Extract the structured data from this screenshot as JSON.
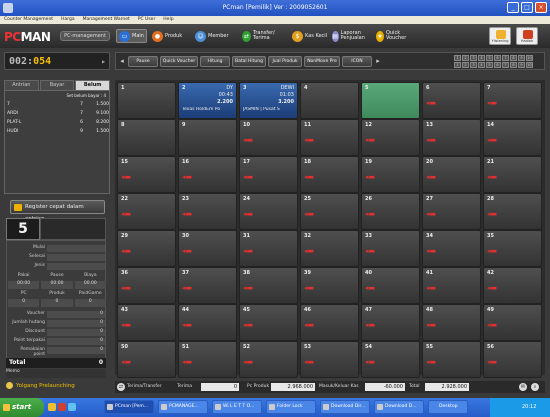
{
  "window": {
    "title": "PCman [Pemilik]  Ver : 2009052601",
    "minimize": "_",
    "maximize": "□",
    "close": "×"
  },
  "menu": [
    "Counter Management",
    "Harga",
    "Management Warnet",
    "PC User",
    "Help"
  ],
  "logo": {
    "pc": "PC",
    "man": "MAN",
    "mode": "PC-management"
  },
  "nav": [
    {
      "label": "Main",
      "icon": "monitor-icon",
      "color": "#2a6fd6"
    },
    {
      "label": "Produk",
      "icon": "cup-icon",
      "color": "#e07020"
    },
    {
      "label": "Member",
      "icon": "members-icon",
      "color": "#4b8fd6"
    },
    {
      "label": "Transfer/ Terima",
      "icon": "transfer-icon",
      "color": "#30a030"
    },
    {
      "label": "Kas Kecil",
      "icon": "cash-icon",
      "color": "#e0a020"
    },
    {
      "label": "Laporan Penjualan",
      "icon": "report-icon",
      "color": "#8a8ad0"
    },
    {
      "label": "Quick Voucher",
      "icon": "voucher-icon",
      "color": "#e8b000"
    }
  ],
  "rightButtons": [
    {
      "label": "Ylistening",
      "icon": "person-icon"
    },
    {
      "label": "Hadiah",
      "icon": "gift-icon"
    }
  ],
  "counter": {
    "prefix": "002:",
    "value": "054"
  },
  "toolbar": [
    "Pause",
    "Quick Voucher",
    "Hitung",
    "Batal Hitung",
    "Jual Produk",
    "NonMove Pre",
    "ICON"
  ],
  "keys": [
    "1",
    "2",
    "3",
    "4",
    "5",
    "6",
    "7",
    "8",
    "9",
    "10",
    "1",
    "2",
    "3",
    "4",
    "5",
    "6",
    "7",
    "8",
    "9",
    "10"
  ],
  "tabs": [
    "Antrian",
    "Bayar",
    "Belum Bayar"
  ],
  "waiting": {
    "subtitle": "Set belum bayar : 4",
    "rows": [
      {
        "name": "7",
        "qty": "7",
        "amount": "1.500"
      },
      {
        "name": "ARDI",
        "qty": "7",
        "amount": "9.100"
      },
      {
        "name": "PLAT-L",
        "qty": "6",
        "amount": "8.200"
      },
      {
        "name": "HUDI",
        "qty": "9",
        "amount": "1.500"
      }
    ]
  },
  "register": "Register cepat dalam antrian",
  "big": "5",
  "info": {
    "mulai": "Mulai",
    "selesai": "Selesai",
    "jenis": "Jenis",
    "h1": [
      "Pakai",
      "Pause",
      "Biaya"
    ],
    "v1": [
      "00:00",
      "00:00",
      "00.00"
    ],
    "h2": [
      "PC",
      "Produk",
      "PaidGame"
    ],
    "v2": [
      "0",
      "0",
      "0"
    ],
    "voucher": "Voucher",
    "voucherVal": "0",
    "jumlah": "Jumlah hutang",
    "jumlahVal": "0",
    "discount": "Discount",
    "discountVal": "0",
    "point": "Point terpakai",
    "pointVal": "0",
    "pemakaian": "Pemakaian point",
    "pemakaianVal": "0",
    "total": "Total",
    "totalVal": "0",
    "memo": "Memo"
  },
  "promo": "Yolgang Prelaunching",
  "grid": [
    {
      "num": "1"
    },
    {
      "num": "2",
      "user": "DY",
      "time": "00:43",
      "amount": "2.200",
      "game": "Texas HoldEm Po",
      "state": "active"
    },
    {
      "num": "3",
      "user": "DEWI",
      "time": "01:03",
      "amount": "3.200",
      "game": "JASMIN | Pusat S",
      "state": "active"
    },
    {
      "num": "4"
    },
    {
      "num": "5",
      "state": "green"
    },
    {
      "num": "6",
      "off": "true"
    },
    {
      "num": "7",
      "off": "true"
    },
    {
      "num": "8"
    },
    {
      "num": "9"
    },
    {
      "num": "10",
      "off": "true"
    },
    {
      "num": "11",
      "off": "true"
    },
    {
      "num": "12",
      "off": "true"
    },
    {
      "num": "13",
      "off": "true"
    },
    {
      "num": "14",
      "off": "true"
    },
    {
      "num": "15",
      "off": "true"
    },
    {
      "num": "16",
      "off": "true"
    },
    {
      "num": "17",
      "off": "true"
    },
    {
      "num": "18",
      "off": "true"
    },
    {
      "num": "19",
      "off": "true"
    },
    {
      "num": "20",
      "off": "true"
    },
    {
      "num": "21",
      "off": "true"
    },
    {
      "num": "22",
      "off": "true"
    },
    {
      "num": "23",
      "off": "true"
    },
    {
      "num": "24",
      "off": "true"
    },
    {
      "num": "25",
      "off": "true"
    },
    {
      "num": "26",
      "off": "true"
    },
    {
      "num": "27",
      "off": "true"
    },
    {
      "num": "28",
      "off": "true"
    },
    {
      "num": "29",
      "off": "true"
    },
    {
      "num": "30",
      "off": "true"
    },
    {
      "num": "31",
      "off": "true"
    },
    {
      "num": "32",
      "off": "true"
    },
    {
      "num": "33",
      "off": "true"
    },
    {
      "num": "34",
      "off": "true"
    },
    {
      "num": "35",
      "off": "true"
    },
    {
      "num": "36",
      "off": "true"
    },
    {
      "num": "37",
      "off": "true"
    },
    {
      "num": "38",
      "off": "true"
    },
    {
      "num": "39",
      "off": "true"
    },
    {
      "num": "40",
      "off": "true"
    },
    {
      "num": "41",
      "off": "true"
    },
    {
      "num": "42",
      "off": "true"
    },
    {
      "num": "43",
      "off": "true"
    },
    {
      "num": "44",
      "off": "true"
    },
    {
      "num": "45",
      "off": "true"
    },
    {
      "num": "46",
      "off": "true"
    },
    {
      "num": "47",
      "off": "true"
    },
    {
      "num": "48",
      "off": "true"
    },
    {
      "num": "49",
      "off": "true"
    },
    {
      "num": "50",
      "off": "true"
    },
    {
      "num": "51",
      "off": "true"
    },
    {
      "num": "52",
      "off": "true"
    },
    {
      "num": "53",
      "off": "true"
    },
    {
      "num": "54",
      "off": "true"
    },
    {
      "num": "55",
      "off": "true"
    },
    {
      "num": "56",
      "off": "true"
    }
  ],
  "offMark": "◂▬",
  "status": {
    "transfer": "Terima/Transfer",
    "terima": "Terima",
    "terimaVal": "0",
    "pcProduk": "Pc Produk",
    "pcVal": "2.968.000",
    "masuk": "Masuk/Keluar Kas",
    "masukVal": "-60.000",
    "total": "Total",
    "totalVal": "2.928.000"
  },
  "taskbar": {
    "start": "start",
    "items": [
      "PCman [Pem...",
      "PCMANAGE...",
      "Wi L E T T O...",
      "Folder Lock",
      "Download Dir...",
      "Download D..."
    ],
    "lang": "Desktop",
    "clock": "20:12"
  }
}
